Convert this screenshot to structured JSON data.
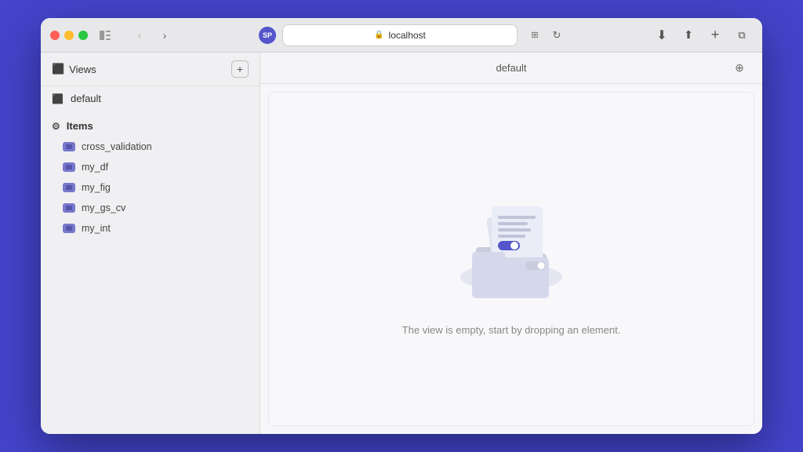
{
  "browser": {
    "url": "localhost",
    "avatar_initials": "SP"
  },
  "sidebar": {
    "views_label": "Views",
    "default_label": "default",
    "items_label": "Items",
    "data_items": [
      {
        "name": "cross_validation"
      },
      {
        "name": "my_df"
      },
      {
        "name": "my_fig"
      },
      {
        "name": "my_gs_cv"
      },
      {
        "name": "my_int"
      }
    ]
  },
  "panel": {
    "title": "default",
    "empty_message": "The view is empty, start by dropping an element."
  },
  "toolbar": {
    "add_label": "+"
  }
}
